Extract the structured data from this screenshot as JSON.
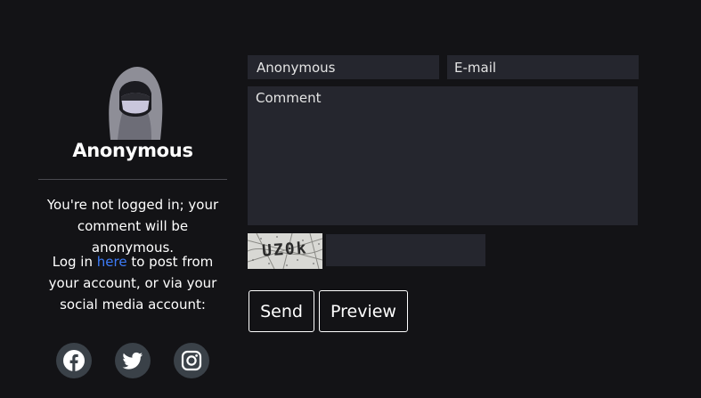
{
  "profile": {
    "username": "Anonymous",
    "notice": "You're not logged in; your comment will be anonymous.",
    "login_before": "Log in ",
    "login_link": "here",
    "login_after": " to post from your account, or via your social media account:"
  },
  "socials": [
    {
      "icon": "facebook-icon"
    },
    {
      "icon": "twitter-icon"
    },
    {
      "icon": "instagram-icon"
    }
  ],
  "form": {
    "name_placeholder": "Anonymous",
    "email_placeholder": "E-mail",
    "comment_placeholder": "Comment",
    "captcha_text": "UZ0k",
    "send_label": "Send",
    "preview_label": "Preview"
  },
  "colors": {
    "background": "#131316",
    "field": "#25262e",
    "link": "#3d7bf7",
    "social_bg": "#3a4148"
  }
}
